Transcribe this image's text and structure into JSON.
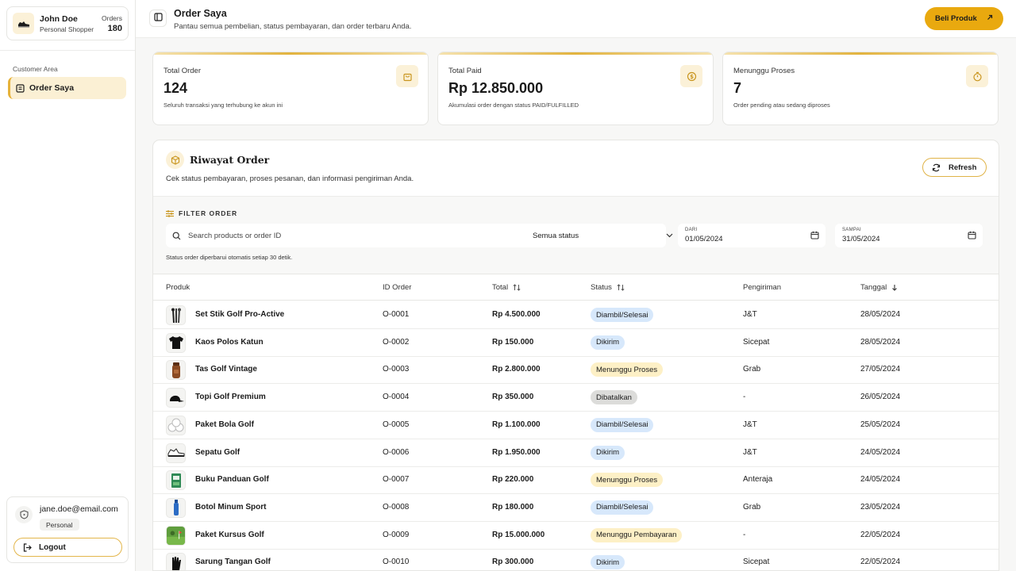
{
  "sidebar": {
    "user": {
      "name": "John Doe",
      "role": "Personal Shopper",
      "orders_label": "Orders",
      "orders_count": "180"
    },
    "section_label": "Customer Area",
    "nav": [
      {
        "label": "Order Saya",
        "icon": "orders-icon",
        "active": true
      }
    ],
    "account": {
      "email": "jane.doe@email.com",
      "badge": "Personal",
      "logout_label": "Logout"
    }
  },
  "header": {
    "title": "Order Saya",
    "subtitle": "Pantau semua pembelian, status pembayaran, dan order terbaru Anda.",
    "buy_label": "Beli Produk"
  },
  "stats": [
    {
      "label": "Total Order",
      "value": "124",
      "desc": "Seluruh transaksi yang terhubung ke akun ini",
      "icon": "shopping-bag-icon"
    },
    {
      "label": "Total Paid",
      "value": "Rp 12.850.000",
      "desc": "Akumulasi order dengan status PAID/FULFILLED",
      "icon": "coin-icon"
    },
    {
      "label": "Menunggu Proses",
      "value": "7",
      "desc": "Order pending atau sedang diproses",
      "icon": "timer-icon"
    }
  ],
  "history": {
    "title": "Riwayat Order",
    "subtitle": "Cek status pembayaran, proses pesanan, dan informasi pengiriman Anda.",
    "refresh_label": "Refresh"
  },
  "filter": {
    "title": "FILTER ORDER",
    "search_placeholder": "Search products or order ID",
    "status_value": "Semua status",
    "from_label": "DARI",
    "from_value": "01/05/2024",
    "to_label": "SAMPAI",
    "to_value": "31/05/2024",
    "note": "Status order diperbarui otomatis setiap 30 detik."
  },
  "table": {
    "headers": {
      "product": "Produk",
      "id": "ID Order",
      "total": "Total",
      "status": "Status",
      "shipping": "Pengiriman",
      "date": "Tanggal"
    },
    "rows": [
      {
        "product": "Set Stik Golf Pro-Active",
        "id": "O-0001",
        "total": "Rp 4.500.000",
        "status": "Diambil/Selesai",
        "shipping": "J&T",
        "date": "28/05/2024",
        "thumb": "golf-clubs-icon"
      },
      {
        "product": "Kaos Polos Katun",
        "id": "O-0002",
        "total": "Rp 150.000",
        "status": "Dikirim",
        "shipping": "Sicepat",
        "date": "28/05/2024",
        "thumb": "tshirt-icon"
      },
      {
        "product": "Tas Golf Vintage",
        "id": "O-0003",
        "total": "Rp 2.800.000",
        "status": "Menunggu Proses",
        "shipping": "Grab",
        "date": "27/05/2024",
        "thumb": "golf-bag-icon"
      },
      {
        "product": "Topi Golf Premium",
        "id": "O-0004",
        "total": "Rp 350.000",
        "status": "Dibatalkan",
        "shipping": "-",
        "date": "26/05/2024",
        "thumb": "cap-icon"
      },
      {
        "product": "Paket Bola Golf",
        "id": "O-0005",
        "total": "Rp 1.100.000",
        "status": "Diambil/Selesai",
        "shipping": "J&T",
        "date": "25/05/2024",
        "thumb": "golf-balls-icon"
      },
      {
        "product": "Sepatu Golf",
        "id": "O-0006",
        "total": "Rp 1.950.000",
        "status": "Dikirim",
        "shipping": "J&T",
        "date": "24/05/2024",
        "thumb": "shoe-icon"
      },
      {
        "product": "Buku Panduan Golf",
        "id": "O-0007",
        "total": "Rp 220.000",
        "status": "Menunggu Proses",
        "shipping": "Anteraja",
        "date": "24/05/2024",
        "thumb": "book-icon"
      },
      {
        "product": "Botol Minum Sport",
        "id": "O-0008",
        "total": "Rp 180.000",
        "status": "Diambil/Selesai",
        "shipping": "Grab",
        "date": "23/05/2024",
        "thumb": "bottle-icon"
      },
      {
        "product": "Paket Kursus Golf",
        "id": "O-0009",
        "total": "Rp 15.000.000",
        "status": "Menunggu Pembayaran",
        "shipping": "-",
        "date": "22/05/2024",
        "thumb": "golf-course-icon"
      },
      {
        "product": "Sarung Tangan Golf",
        "id": "O-0010",
        "total": "Rp 300.000",
        "status": "Dikirim",
        "shipping": "Sicepat",
        "date": "22/05/2024",
        "thumb": "glove-icon"
      }
    ]
  },
  "colors": {
    "accent": "#e9a90f",
    "accent_soft": "#fbf1d8",
    "status_blue_bg": "#d7e8fb",
    "status_yellow_bg": "#fdf0c6",
    "status_gray_bg": "#dcdcda"
  }
}
